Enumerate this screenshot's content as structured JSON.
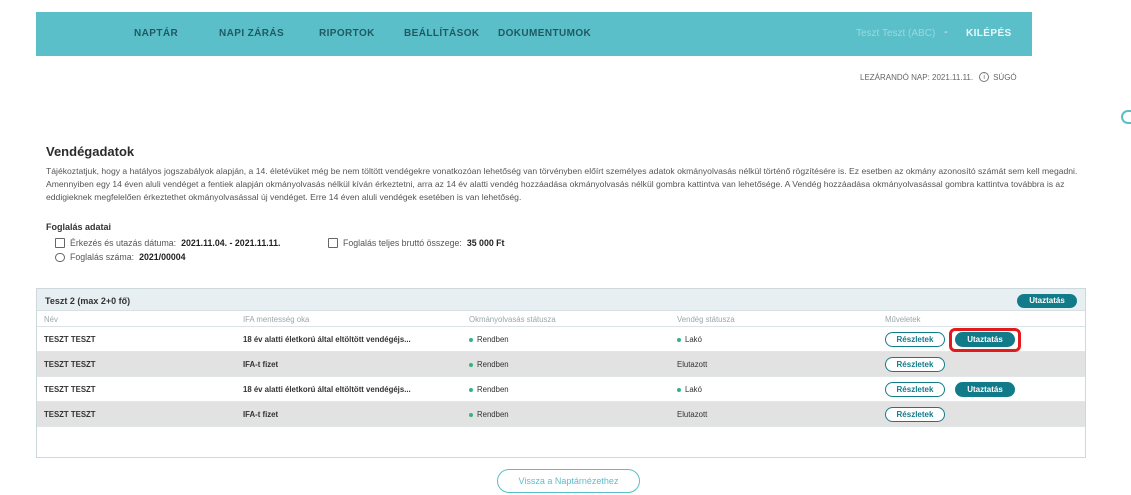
{
  "nav": {
    "items": [
      "NAPTÁR",
      "NAPI ZÁRÁS",
      "RIPORTOK",
      "BEÁLLÍTÁSOK",
      "DOKUMENTUMOK"
    ],
    "user": "Teszt Teszt (ABC)",
    "logout": "KILÉPÉS"
  },
  "meta": {
    "closing_day": "LEZÁRANDÓ NAP: 2021.11.11.",
    "help": "SÚGÓ"
  },
  "page": {
    "title": "Vendégadatok",
    "intro": "Tájékoztatjuk, hogy a hatályos jogszabályok alapján, a 14. életévüket még be nem töltött vendégekre vonatkozóan lehetőség van törvényben előírt személyes adatok okmányolvasás nélkül történő rögzítésére is. Ez esetben az okmány azonosító számát sem kell megadni. Amennyiben egy 14 éven aluli vendéget a fentiek alapján okmányolvasás nélkül kíván érkeztetni, arra az 14 év alatti vendég hozzáadása okmányolvasás nélkül gombra kattintva van lehetősége. A Vendég hozzáadása okmányolvasással gombra kattintva továbbra is az eddigieknek megfelelően érkeztethet okmányolvasással új vendéget. Erre 14 éven aluli vendégek esetében is van lehetőség."
  },
  "booking": {
    "section_title": "Foglalás adatai",
    "arrival_label": "Érkezés és utazás dátuma:",
    "arrival_value": "2021.11.04. - 2021.11.11.",
    "total_label": "Foglalás teljes bruttó összege:",
    "total_value": "35 000 Ft",
    "number_label": "Foglalás száma:",
    "number_value": "2021/00004"
  },
  "panel": {
    "title": "Teszt 2 (max 2+0 fő)",
    "header_button": "Utaztatás",
    "columns": [
      "Név",
      "IFA mentesség oka",
      "Okmányolvasás státusza",
      "Vendég státusza",
      "Műveletek"
    ],
    "rows": [
      {
        "name": "TESZT TESZT",
        "reason": "18 év alatti életkorú által eltöltött vendégéjs...",
        "doc_status": "Rendben",
        "guest_status": "Lakó",
        "details": "Részletek",
        "action": "Utaztatás"
      },
      {
        "name": "TESZT TESZT",
        "reason": "IFA-t fizet",
        "doc_status": "Rendben",
        "guest_status": "Elutazott",
        "details": "Részletek",
        "action": ""
      },
      {
        "name": "TESZT TESZT",
        "reason": "18 év alatti életkorú által eltöltött vendégéjs...",
        "doc_status": "Rendben",
        "guest_status": "Lakó",
        "details": "Részletek",
        "action": "Utaztatás"
      },
      {
        "name": "TESZT TESZT",
        "reason": "IFA-t fizet",
        "doc_status": "Rendben",
        "guest_status": "Elutazott",
        "details": "Részletek",
        "action": ""
      }
    ]
  },
  "footer": {
    "back_button": "Vissza a Naptárnézethez"
  }
}
